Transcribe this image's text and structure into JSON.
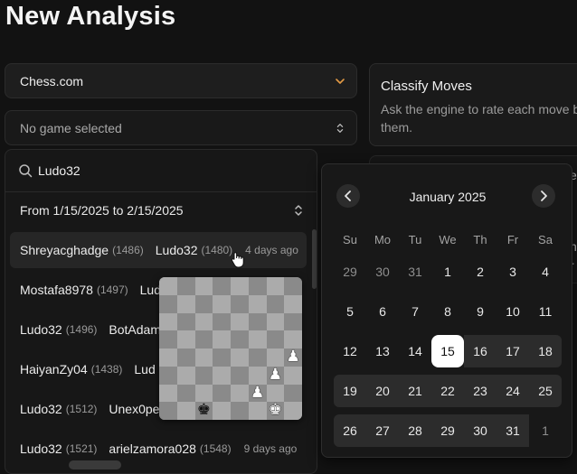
{
  "page": {
    "title": "New Analysis"
  },
  "platform_select": {
    "value": "Chess.com"
  },
  "game_select": {
    "value": "No game selected"
  },
  "classify": {
    "title": "Classify Moves",
    "description": "Ask the engine to rate each move b them.",
    "description_line1": "Ask the engine to rate each move b",
    "description_line2": "them."
  },
  "search": {
    "value": "Ludo32"
  },
  "date_range": {
    "label": "From 1/15/2025 to 2/15/2025"
  },
  "games": [
    {
      "white": "Shreyacghadge",
      "white_rating": "(1486)",
      "black": "Ludo32",
      "black_rating": "(1480)",
      "when": "4 days ago"
    },
    {
      "white": "Mostafa8978",
      "white_rating": "(1497)",
      "black": "Lud",
      "black_rating": "",
      "when": ""
    },
    {
      "white": "Ludo32",
      "white_rating": "(1496)",
      "black": "BotAdam",
      "black_rating": "",
      "when": ""
    },
    {
      "white": "HaiyanZy04",
      "white_rating": "(1438)",
      "black": "Lud",
      "black_rating": "",
      "when": ""
    },
    {
      "white": "Ludo32",
      "white_rating": "(1512)",
      "black": "Unex0pe",
      "black_rating": "",
      "when": ""
    },
    {
      "white": "Ludo32",
      "white_rating": "(1521)",
      "black": "arielzamora028",
      "black_rating": "(1548)",
      "when": "9 days ago"
    }
  ],
  "board_preview": {
    "pieces": [
      {
        "glyph": "♟",
        "side": "white",
        "file": 7,
        "rank": 3
      },
      {
        "glyph": "♟",
        "side": "white",
        "file": 6,
        "rank": 2
      },
      {
        "glyph": "♟",
        "side": "white",
        "file": 5,
        "rank": 1
      },
      {
        "glyph": "♚",
        "side": "black",
        "file": 2,
        "rank": 0
      },
      {
        "glyph": "♚",
        "side": "white",
        "file": 6,
        "rank": 0
      }
    ]
  },
  "calendar": {
    "month": "January 2025",
    "weekdays": [
      "Su",
      "Mo",
      "Tu",
      "We",
      "Th",
      "Fr",
      "Sa"
    ],
    "weeks": [
      [
        "29",
        "30",
        "31",
        "1",
        "2",
        "3",
        "4"
      ],
      [
        "5",
        "6",
        "7",
        "8",
        "9",
        "10",
        "11"
      ],
      [
        "12",
        "13",
        "14",
        "15",
        "16",
        "17",
        "18"
      ],
      [
        "19",
        "20",
        "21",
        "22",
        "23",
        "24",
        "25"
      ],
      [
        "26",
        "27",
        "28",
        "29",
        "30",
        "31",
        "1"
      ]
    ],
    "selected_day": "15"
  },
  "colors": {
    "background": "#121212",
    "panel": "#171717",
    "selected": "#ffffff",
    "range": "#2c2c2c"
  }
}
